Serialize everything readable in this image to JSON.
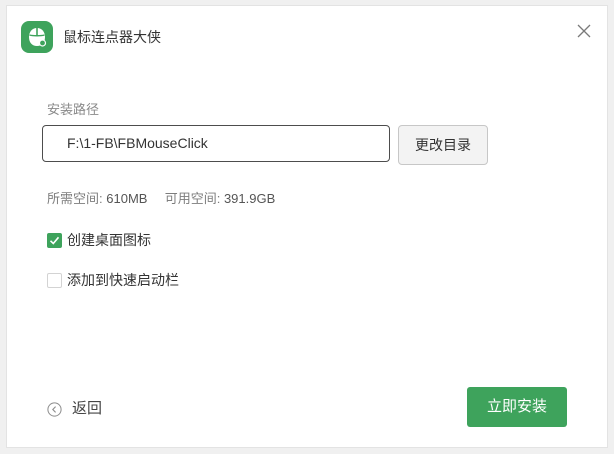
{
  "app": {
    "title": "鼠标连点器大侠",
    "icon": "mouse-app-icon",
    "accent_color": "#3ea35c"
  },
  "window_controls": {
    "close_icon": "close-icon"
  },
  "install": {
    "path_label": "安装路径",
    "path_value": "F:\\1-FB\\FBMouseClick",
    "change_dir_label": "更改目录",
    "required_space_label": "所需空间:",
    "required_space_value": "610MB",
    "available_space_label": "可用空间:",
    "available_space_value": "391.9GB"
  },
  "options": {
    "desktop_shortcut": {
      "label": "创建桌面图标",
      "checked": true
    },
    "quick_launch": {
      "label": "添加到快速启动栏",
      "checked": false
    }
  },
  "footer": {
    "back_label": "返回",
    "back_icon": "back-arrow-icon",
    "install_label": "立即安装"
  }
}
